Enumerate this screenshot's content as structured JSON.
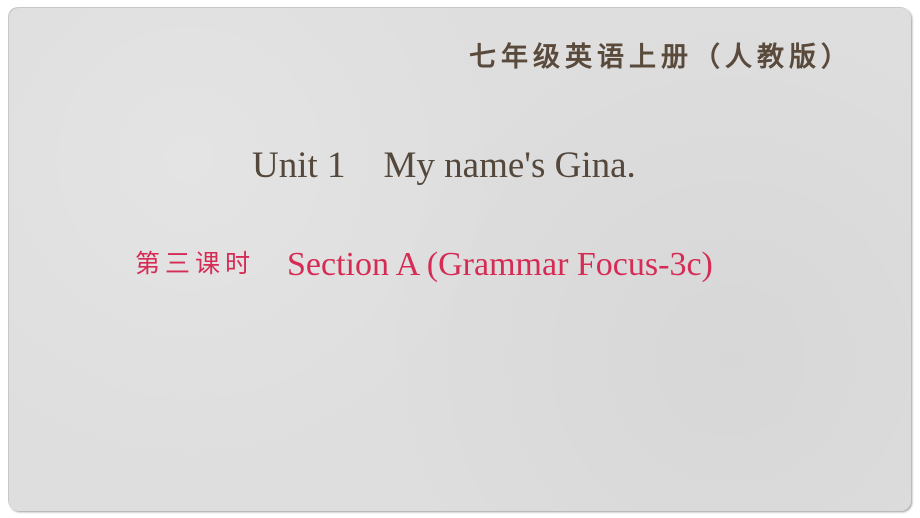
{
  "slide": {
    "book_title": "七年级英语上册（人教版）",
    "unit_label": "Unit 1",
    "unit_name": "My name's Gina.",
    "lesson_cn": "第三课时",
    "lesson_en": "Section A (Grammar Focus-3c)"
  },
  "colors": {
    "background": "#dedede",
    "title_text": "#5a4a3c",
    "accent": "#d52b54"
  }
}
